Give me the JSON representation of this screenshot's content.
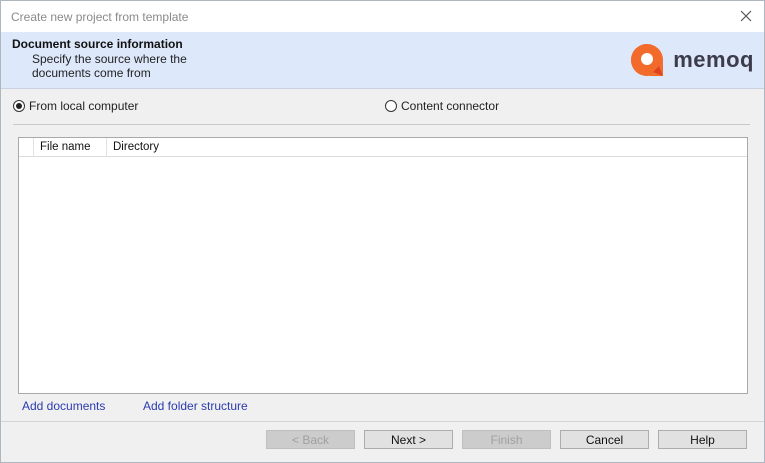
{
  "window": {
    "title": "Create new project from template"
  },
  "header": {
    "title": "Document source information",
    "description": "Specify the source where the documents come from",
    "logo_text": "memoq",
    "logo_color": "#f26b2b"
  },
  "source_options": {
    "local": {
      "label": "From local computer",
      "selected": true
    },
    "connector": {
      "label": "Content connector",
      "selected": false
    }
  },
  "file_list": {
    "columns": [
      "File name",
      "Directory"
    ],
    "rows": []
  },
  "links": {
    "add_documents": "Add documents",
    "add_folder_structure": "Add folder structure"
  },
  "buttons": {
    "back": {
      "label": "< Back",
      "enabled": false
    },
    "next": {
      "label": "Next >",
      "enabled": true
    },
    "finish": {
      "label": "Finish",
      "enabled": false
    },
    "cancel": {
      "label": "Cancel",
      "enabled": true
    },
    "help": {
      "label": "Help",
      "enabled": true
    }
  }
}
